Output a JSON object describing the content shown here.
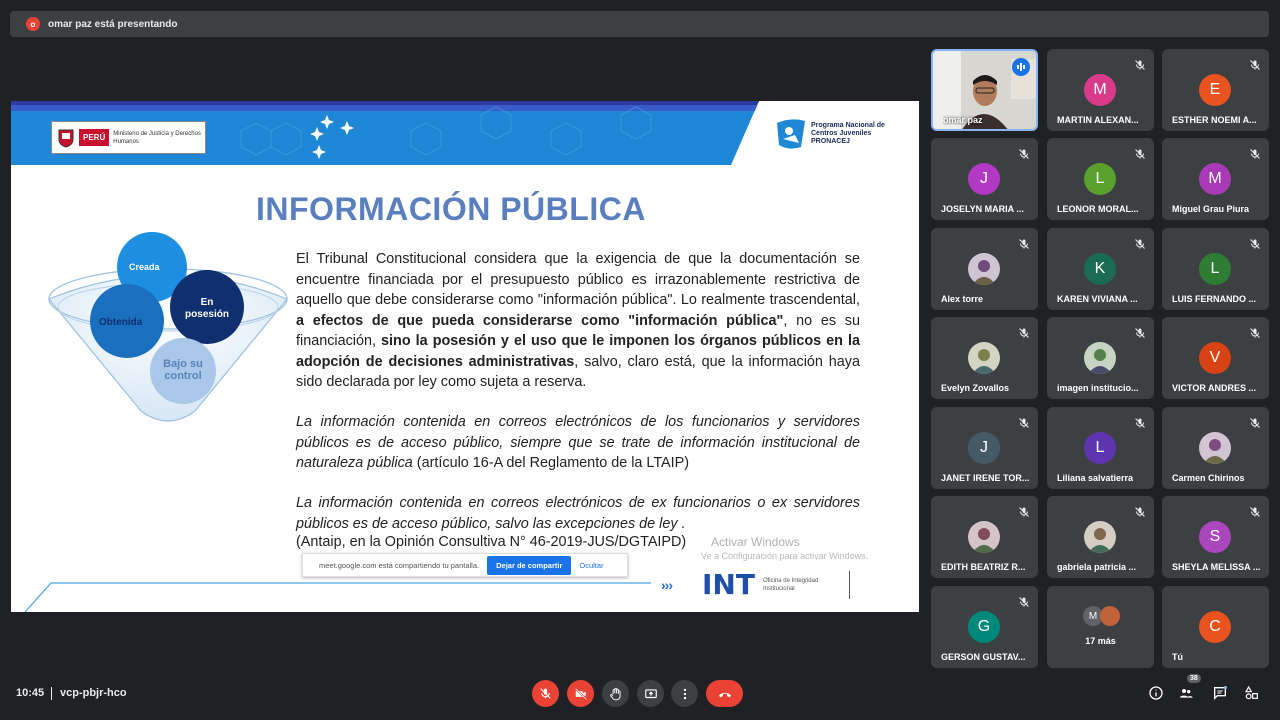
{
  "presenting": {
    "label": "omar paz está presentando"
  },
  "slide": {
    "title": "INFORMACIÓN PÚBLICA",
    "gov_logo": {
      "country": "PERÚ",
      "ministry": "Ministerio de Justicia y Derechos Humanos"
    },
    "pronacej": "Programa Nacional de Centros Juveniles PRONACEJ",
    "diagram": {
      "creada": "Creada",
      "obtenida": "Obtenida",
      "posesion": "En posesión",
      "control": "Bajo su control"
    },
    "para1_a": "El Tribunal Constitucional considera que la exigencia de que la documentación se encuentre financiada por el presupuesto público es irrazonablemente restrictiva de aquello que debe considerarse como \"información pública\". Lo realmente trascendental, ",
    "para1_b": "a efectos de que pueda considerarse como \"información pública\"",
    "para1_c": ", no es su financiación, ",
    "para1_d": "sino la posesión y el uso que le imponen los órganos públicos en la adopción de decisiones administrativas",
    "para1_e": ", salvo, claro está, que la información haya sido declarada por ley como sujeta a reserva.",
    "para2": "La información contenida en correos electrónicos de los funcionarios y servidores públicos es de acceso público, siempre que se trate de información institucional de naturaleza pública",
    "para2_ref": " (artículo 16-A del Reglamento de la LTAIP)",
    "para3": "La información contenida en correos electrónicos de ex funcionarios o ex servidores públicos es de acceso público, salvo las excepciones de ley .",
    "cite": "(Antaip, en la Opinión Consultiva N° 46-2019-JUS/DGTAIPD)",
    "activate_1": "Activar Windows",
    "activate_2": "Ve a Configuración para activar Windows.",
    "int_logo": "INT",
    "int_sub": "Oficina de Integridad Institucional"
  },
  "share_bar": {
    "text": "meet.google.com está compartiendo tu pantalla.",
    "stop": "Dejar de compartir",
    "hide": "Ocultar"
  },
  "participants": [
    {
      "name": "omar paz",
      "type": "video"
    },
    {
      "name": "MARTIN ALEXAN...",
      "initial": "M",
      "color": "#d93b8a"
    },
    {
      "name": "ESTHER NOEMI A...",
      "initial": "E",
      "color": "#e8531f"
    },
    {
      "name": "JOSELYN MARIA ...",
      "initial": "J",
      "color": "#b239c4"
    },
    {
      "name": "LEONOR MORAL...",
      "initial": "L",
      "color": "#5aa02c"
    },
    {
      "name": "Miguel Grau Piura",
      "initial": "M",
      "color": "#a83bb5"
    },
    {
      "name": "Alex torre",
      "type": "photo"
    },
    {
      "name": "KAREN VIVIANA ...",
      "initial": "K",
      "color": "#1b6b52"
    },
    {
      "name": "LUIS FERNANDO ...",
      "initial": "L",
      "color": "#2e7d32"
    },
    {
      "name": "Evelyn Zovallos",
      "type": "photo"
    },
    {
      "name": "imagen institucio...",
      "type": "photo"
    },
    {
      "name": "VICTOR ANDRES ...",
      "initial": "V",
      "color": "#d84315"
    },
    {
      "name": "JANET IRENE TOR...",
      "initial": "J",
      "color": "#455a64"
    },
    {
      "name": "Liliana salvatierra",
      "initial": "L",
      "color": "#5e35b1"
    },
    {
      "name": "Carmen Chirinos",
      "type": "photo"
    },
    {
      "name": "EDITH BEATRIZ R...",
      "type": "photo"
    },
    {
      "name": "gabriela patricia ...",
      "type": "photo"
    },
    {
      "name": "SHEYLA MELISSA ...",
      "initial": "S",
      "color": "#ab47bc"
    },
    {
      "name": "GERSON GUSTAV...",
      "initial": "G",
      "color": "#00897b"
    },
    {
      "name": "17 más",
      "type": "more",
      "initial": "M"
    },
    {
      "name": "Tú",
      "initial": "C",
      "color": "#e8531f"
    }
  ],
  "footer": {
    "time": "10:45",
    "meeting_code": "vcp-pbjr-hco",
    "participant_count": "38"
  },
  "colors": {
    "background": "#202124",
    "tile": "#3c4043",
    "danger": "#ea4335",
    "accent": "#1a73e8"
  }
}
